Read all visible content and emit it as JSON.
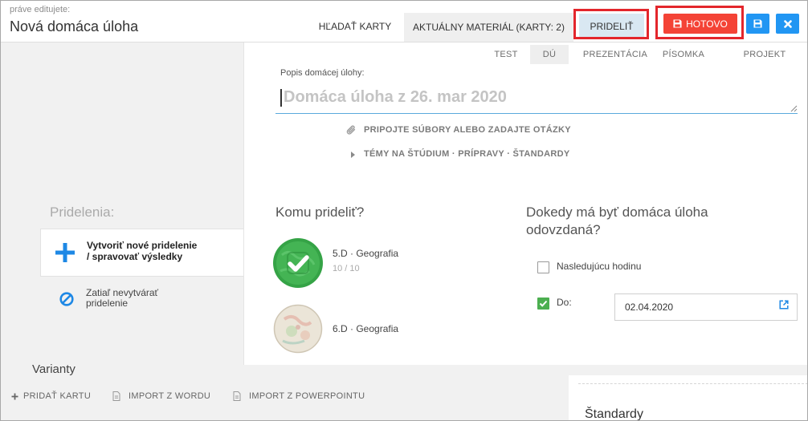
{
  "colors": {
    "danger": "#f44336",
    "primary": "#2196f3",
    "success": "#4caf50",
    "highlight": "#d9e8f2",
    "annotation": "#e3262c",
    "input_underline": "#5aa9dc",
    "icon_blue": "#1e88e5"
  },
  "header": {
    "editing_label": "práve editujete:",
    "title": "Nová domáca úloha",
    "search_cards": "HĽADAŤ KARTY",
    "current_material": "AKTUÁLNY MATERIÁL (KARTY: 2)",
    "assign": {
      "label": "PRIDELIŤ",
      "active": true
    },
    "done": {
      "label": "HOTOVO",
      "icon": "floppy-disk-icon"
    },
    "save_button": {
      "icon": "floppy-disk-icon"
    },
    "close_button": {
      "icon": "close-icon"
    }
  },
  "type_tabs": [
    {
      "label": "TEST",
      "selected": false
    },
    {
      "label": "DÚ",
      "selected": true
    },
    {
      "label": "PREZENTÁCIA",
      "selected": false
    },
    {
      "label": "PÍSOMKA",
      "selected": false
    },
    {
      "label": "PROJEKT",
      "selected": false
    }
  ],
  "description": {
    "label": "Popis domácej úlohy:",
    "placeholder": "Domáca úloha z 26. mar 2020"
  },
  "attach": {
    "label": "PRIPOJTE SÚBORY ALEBO ZADAJTE OTÁZKY",
    "icon": "paperclip-icon"
  },
  "topics": {
    "label": "TÉMY NA ŠTÚDIUM · PRÍPRAVY · ŠTANDARDY",
    "icon": "caret-right-icon"
  },
  "assignments": {
    "heading": "Pridelenia:",
    "options": [
      {
        "line1": "Vytvoriť nové pridelenie",
        "line2": "/ spravovať výsledky",
        "icon": "plus-icon",
        "selected": true
      },
      {
        "line1": "Zatiaľ nevytvárať",
        "line2": "pridelenie",
        "icon": "ban-icon",
        "selected": false
      }
    ]
  },
  "recipients": {
    "heading": "Komu prideliť?",
    "classes": [
      {
        "name": "5.D · Geografia",
        "progress": "10 / 10",
        "selected": true,
        "icon": "class-map-checked-icon"
      },
      {
        "name": "6.D · Geografia",
        "selected": false,
        "icon": "class-map-icon"
      }
    ]
  },
  "deadline": {
    "heading": "Dokedy má byť domáca úloha odovzdaná?",
    "next_lesson": {
      "label": "Nasledujúcu hodinu",
      "checked": false
    },
    "until": {
      "label": "Do:",
      "checked": true,
      "date": "02.04.2020",
      "icon": "calendar-edit-icon"
    }
  },
  "variants": {
    "heading": "Varianty",
    "actions": [
      {
        "label": "PRIDAŤ KARTU",
        "icon": "plus-icon"
      },
      {
        "label": "IMPORT Z WORDU",
        "icon": "document-icon"
      },
      {
        "label": "IMPORT Z POWERPOINTU",
        "icon": "document-icon"
      }
    ]
  },
  "standards": {
    "heading": "Štandardy"
  }
}
